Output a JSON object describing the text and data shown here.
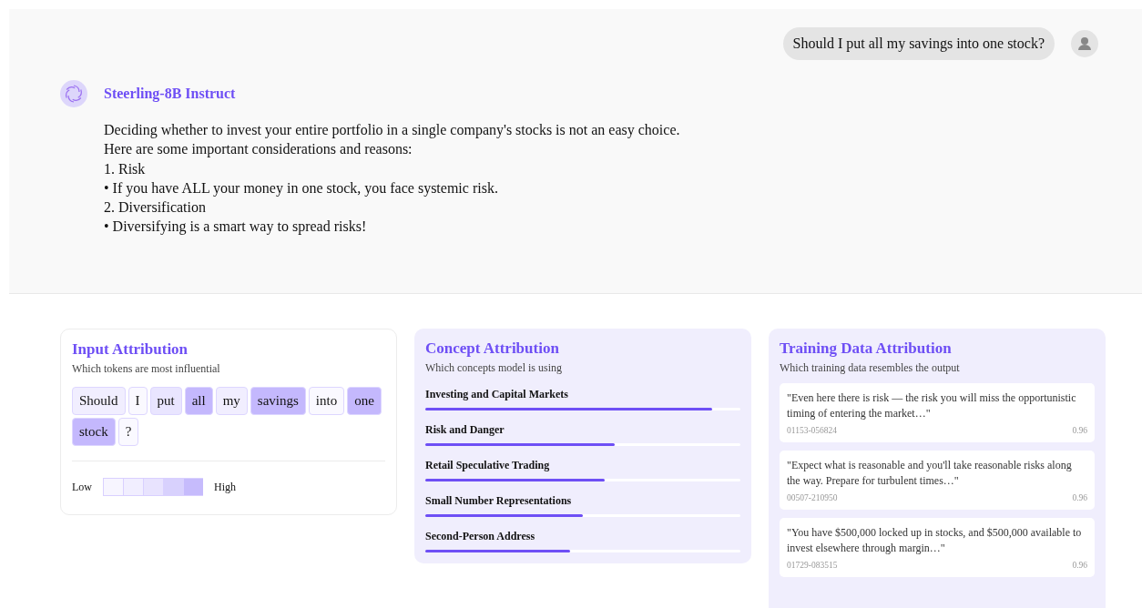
{
  "chat": {
    "user_message": "Should I put all my savings into one stock?",
    "assistant": {
      "name": "Steerling-8B Instruct",
      "lines": [
        "Deciding whether to invest your entire portfolio in a single company's stocks is not an easy choice.",
        "Here are some important considerations and reasons:",
        "1. Risk",
        "• If you have ALL your money in one stock, you face systemic risk.",
        "2. Diversification",
        "• Diversifying is a smart way to spread risks!"
      ]
    }
  },
  "input_attribution": {
    "title": "Input Attribution",
    "subtitle": "Which tokens are most influential",
    "tokens": [
      {
        "text": "Should",
        "color": "#f1eeff"
      },
      {
        "text": "I",
        "color": "#faf9ff"
      },
      {
        "text": "put",
        "color": "#e9e5ff"
      },
      {
        "text": "all",
        "color": "#c4b8fd"
      },
      {
        "text": "my",
        "color": "#f1eeff"
      },
      {
        "text": "savings",
        "color": "#c4b8fd"
      },
      {
        "text": "into",
        "color": "#faf9ff"
      },
      {
        "text": "one",
        "color": "#c4b8fd"
      },
      {
        "text": "stock",
        "color": "#c4b8fd"
      },
      {
        "text": "?",
        "color": "#faf9ff"
      }
    ],
    "legend_low": "Low",
    "legend_high": "High"
  },
  "concept_attribution": {
    "title": "Concept Attribution",
    "subtitle": "Which concepts model is using",
    "concepts": [
      {
        "name": "Investing and Capital Markets",
        "level": 0.91
      },
      {
        "name": "Risk and Danger",
        "level": 0.6
      },
      {
        "name": "Retail Speculative Trading",
        "level": 0.57
      },
      {
        "name": "Small Number Representations",
        "level": 0.5
      },
      {
        "name": "Second-Person Address",
        "level": 0.46
      }
    ]
  },
  "training_data_attribution": {
    "title": "Training Data Attribution",
    "subtitle": "Which training data resembles the output",
    "items": [
      {
        "quote": "\"Even here there is risk — the risk you will miss the opportunistic timing of entering the market…\"",
        "id": "01153-056824",
        "score": "0.96"
      },
      {
        "quote": "\"Expect what is reasonable and you'll take reasonable risks along the way. Prepare for turbulent times…\"",
        "id": "00507-210950",
        "score": "0.96"
      },
      {
        "quote": "\"You have $500,000 locked up in stocks, and $500,000 available to invest elsewhere through margin…\"",
        "id": "01729-083515",
        "score": "0.96"
      }
    ]
  }
}
